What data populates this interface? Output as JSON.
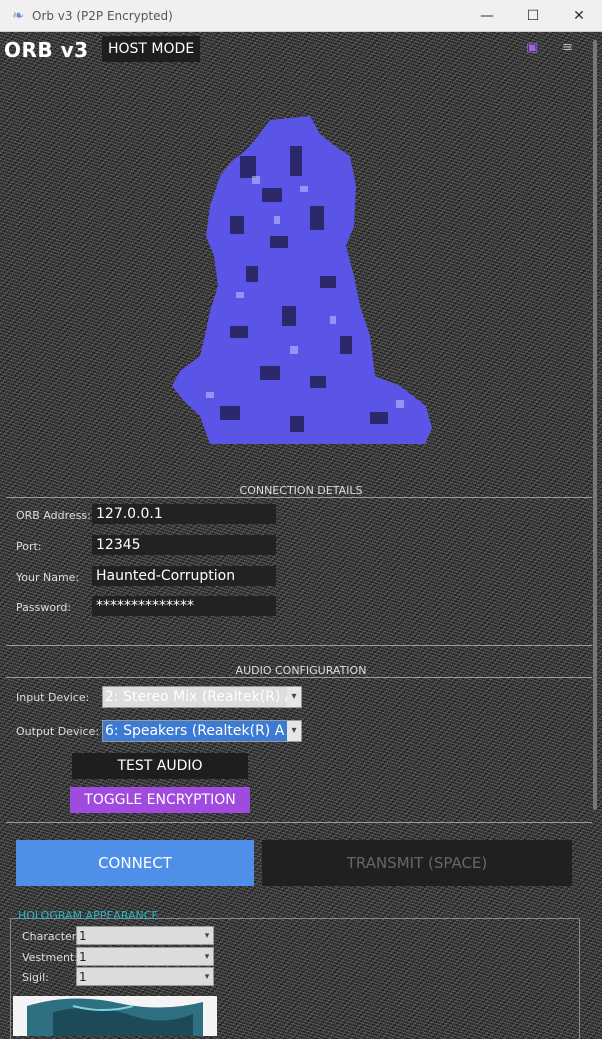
{
  "window": {
    "title": "Orb v3 (P2P Encrypted)",
    "minimize_icon": "minimize-icon",
    "maximize_icon": "maximize-icon",
    "close_icon": "close-icon"
  },
  "header": {
    "brand": "ORB v3",
    "mode_button": "HOST MODE"
  },
  "connection": {
    "section_title": "CONNECTION DETAILS",
    "fields": [
      {
        "label": "ORB Address:",
        "value": "127.0.0.1"
      },
      {
        "label": "Port:",
        "value": "12345"
      },
      {
        "label": "Your Name:",
        "value": "Haunted-Corruption"
      },
      {
        "label": "Password:",
        "value": "**************"
      }
    ]
  },
  "audio": {
    "section_title": "AUDIO CONFIGURATION",
    "input_label": "Input Device:",
    "input_value": "2: Stereo Mix (Realtek(R) A",
    "output_label": "Output Device:",
    "output_value": "6: Speakers (Realtek(R) A",
    "test_button": "TEST AUDIO",
    "encryption_button": "TOGGLE ENCRYPTION"
  },
  "actions": {
    "connect": "CONNECT",
    "transmit": "TRANSMIT (SPACE)"
  },
  "holo": {
    "section_title": "HOLOGRAM APPEARANCE",
    "rows": [
      {
        "label": "Character:",
        "value": "1"
      },
      {
        "label": "Vestment:",
        "value": "1"
      },
      {
        "label": "Sigil:",
        "value": "1"
      }
    ]
  },
  "colors": {
    "accent_purple": "#a04ae0",
    "connect_blue": "#4e8fea",
    "hologram_blue": "#5a55e6",
    "holo_title_cyan": "#2ab6c4"
  }
}
